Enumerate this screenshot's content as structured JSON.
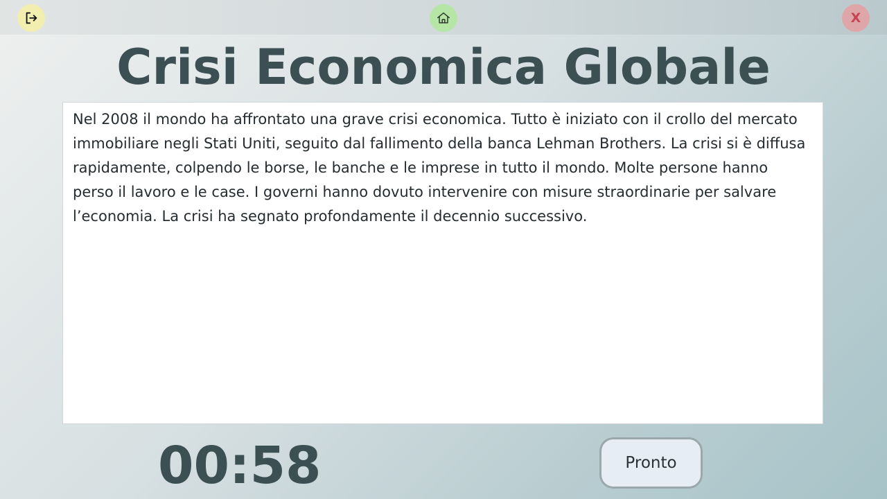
{
  "topbar": {
    "logout_icon": "logout-icon",
    "home_icon": "home-icon",
    "close_label": "X"
  },
  "page": {
    "title": "Crisi Economica Globale",
    "text": "Nel 2008 il mondo ha affrontato una grave crisi economica. Tutto è iniziato con il crollo del mercato immobiliare negli Stati Uniti, seguito dal fallimento della banca Lehman Brothers. La crisi si è diffusa rapidamente, colpendo le borse, le banche e le imprese in tutto il mondo. Molte persone hanno perso il lavoro e le case. I governi hanno dovuto intervenire con misure straordinarie per salvare l’economia. La crisi ha segnato profondamente il decennio successivo."
  },
  "footer": {
    "timer": "00:58",
    "ready_label": "Pronto"
  },
  "colors": {
    "title": "#3c4f53",
    "logout_bg": "#f1eeaf",
    "home_bg": "#b5e6a6",
    "close_bg": "#dea6a8",
    "close_fg": "#c74552",
    "ready_bg": "#e6edf4"
  }
}
